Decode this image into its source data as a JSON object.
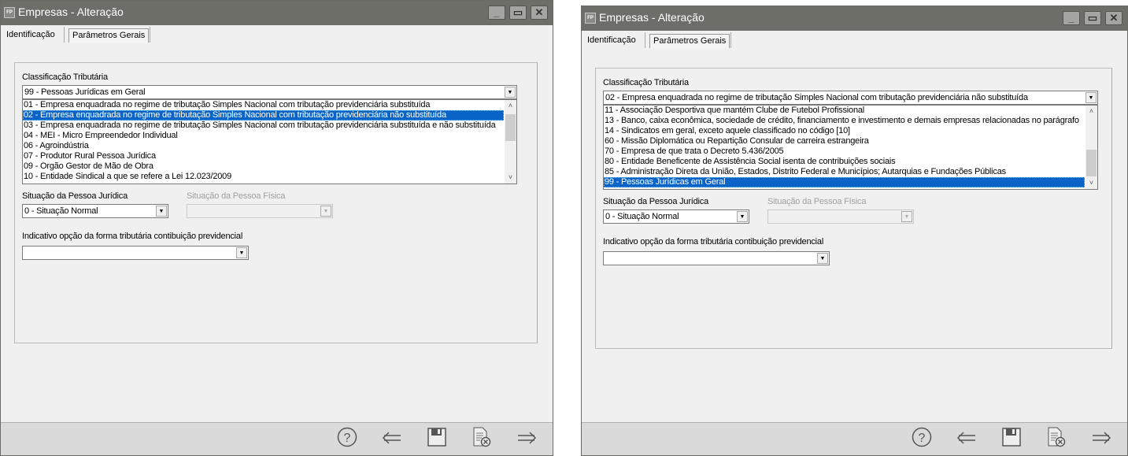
{
  "windows": [
    {
      "title": "Empresas - Alteração",
      "app_icon": "FP",
      "tabs": [
        {
          "label": "Identificação",
          "active": false
        },
        {
          "label": "Parâmetros Gerais",
          "active": true
        }
      ],
      "classificacao": {
        "label": "Classificação Tributária",
        "value": "99 -  Pessoas Jurídicas em Geral",
        "options": [
          "01 - Empresa enquadrada no regime de tributação Simples Nacional com tributação previdenciária substituída",
          "02 - Empresa enquadrada no regime de tributação Simples Nacional com tributação previdenciária não substituída",
          "03 - Empresa enquadrada no regime de tributação Simples Nacional com tributação previdenciária substituída e não substituída",
          "04 - MEI - Micro Empreendedor Individual",
          "06 - Agroindústria",
          "07 - Produtor Rural Pessoa Jurídica",
          "09 - Órgão Gestor de Mão de Obra",
          "10 - Entidade Sindical a que se refere a Lei 12.023/2009"
        ],
        "selected_index": 1,
        "scroll_position": 0.0
      },
      "situacao_pj": {
        "label": "Situação da Pessoa Jurídica",
        "value": "0 - Situação Normal"
      },
      "situacao_pf": {
        "label": "Situação da Pessoa Física",
        "value": "",
        "disabled": true
      },
      "indicativo": {
        "label": "Indicativo opção da forma tributária contibuição previdencial",
        "value": ""
      }
    },
    {
      "title": "Empresas - Alteração",
      "app_icon": "FP",
      "tabs": [
        {
          "label": "Identificação",
          "active": false
        },
        {
          "label": "Parâmetros Gerais",
          "active": true
        }
      ],
      "classificacao": {
        "label": "Classificação Tributária",
        "value": "02 - Empresa enquadrada no regime de tributação Simples Nacional com tributação previdenciária não substituída",
        "options": [
          "11 - Associação Desportiva que mantém Clube de Futebol Profissional",
          "13 - Banco, caixa econômica, sociedade de crédito, financiamento e investimento e demais empresas relacionadas no parágrafo",
          "14 - Sindicatos em geral, exceto aquele classificado no código [10]",
          "60 - Missão Diplomática ou Repartição Consular de carreira estrangeira",
          "70 - Empresa de que trata o Decreto 5.436/2005",
          "80 - Entidade Beneficente de Assistência Social isenta de contribuições sociais",
          "85 - Administração Direta da União, Estados, Distrito Federal e Municípios; Autarquias e Fundações Públicas",
          "99 -  Pessoas Jurídicas em Geral"
        ],
        "selected_index": 7,
        "scroll_position": 1.0
      },
      "situacao_pj": {
        "label": "Situação da Pessoa Jurídica",
        "value": "0 - Situação Normal"
      },
      "situacao_pf": {
        "label": "Situação da Pessoa Física",
        "value": "",
        "disabled": true
      },
      "indicativo": {
        "label": "Indicativo opção da forma tributária contibuição previdencial",
        "value": ""
      }
    }
  ],
  "titlebar_buttons": [
    "minimize-icon",
    "maximize-icon",
    "close-icon"
  ],
  "toolbar_icons": [
    "help-icon",
    "arrow-left-icon",
    "save-icon",
    "cancel-document-icon",
    "arrow-right-icon"
  ],
  "colors": {
    "titlebar": "#6e6e69",
    "selection": "#0a64c8",
    "bottombar": "#dadada"
  }
}
